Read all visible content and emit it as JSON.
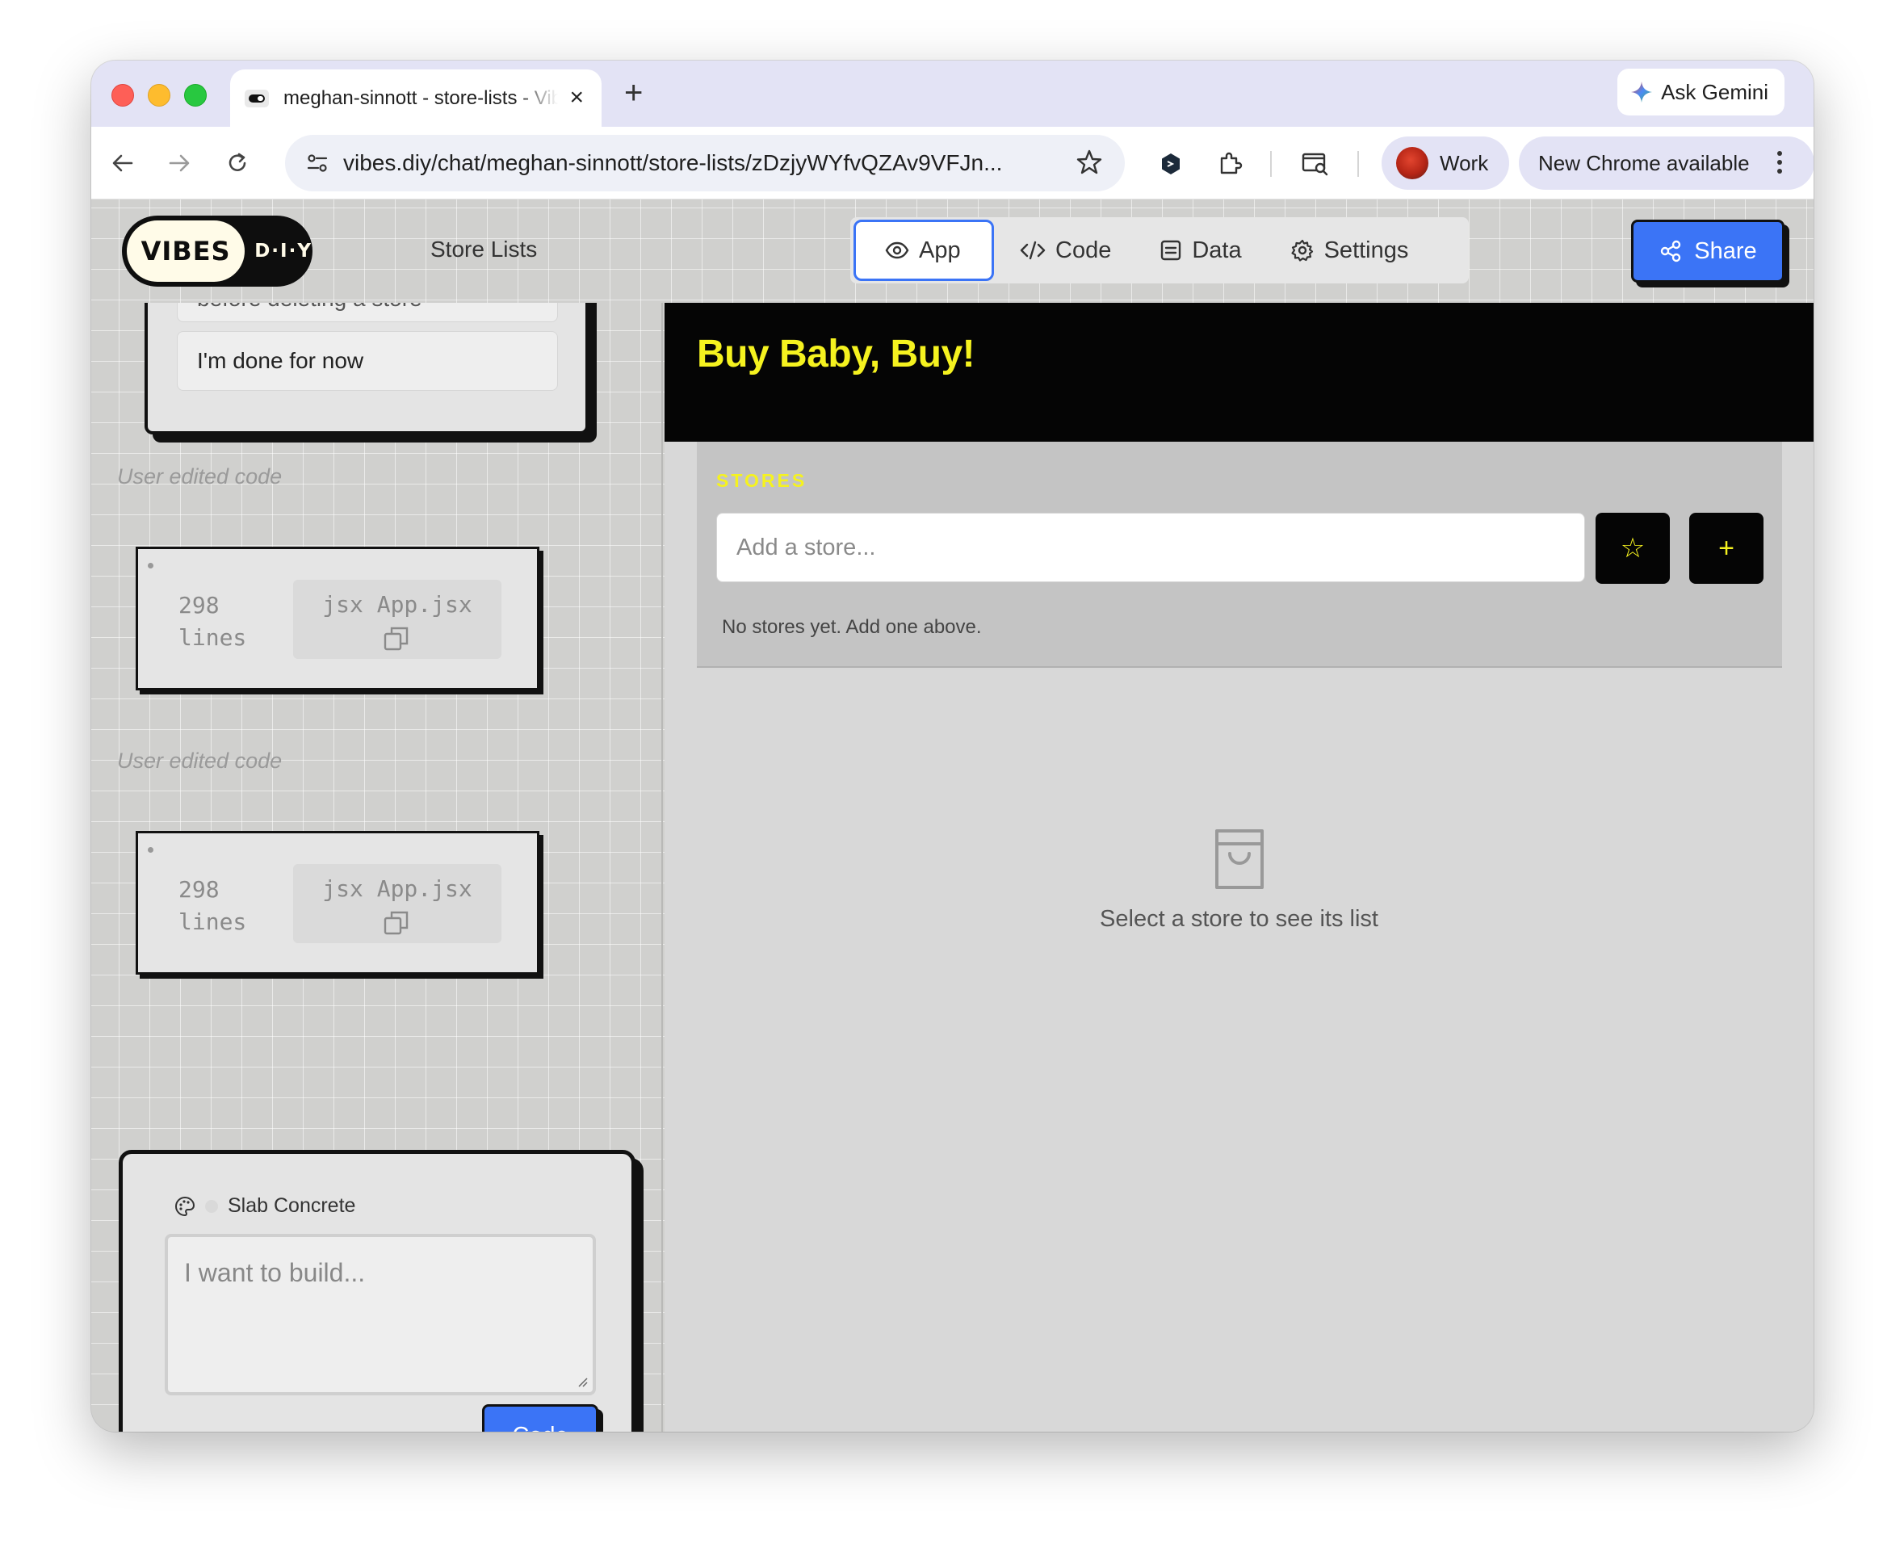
{
  "browser": {
    "tab_title": "meghan-sinnott - store-lists - Vibes DIY",
    "url": "vibes.diy/chat/meghan-sinnott/store-lists/zDzjyWYfvQZAv9VFJn...",
    "ask_gemini": "Ask Gemini",
    "profile_label": "Work",
    "update_label": "New Chrome available"
  },
  "header": {
    "logo_text": "VIBES",
    "logo_suffix": "D·I·Y",
    "page_title": "Store Lists",
    "tabs": [
      {
        "label": "App",
        "icon": "eye-icon",
        "active": true
      },
      {
        "label": "Code",
        "icon": "code-icon",
        "active": false
      },
      {
        "label": "Data",
        "icon": "database-icon",
        "active": false
      },
      {
        "label": "Settings",
        "icon": "gear-icon",
        "active": false
      }
    ],
    "share_label": "Share"
  },
  "chat": {
    "suggestion_partial": "before deleting a store",
    "suggestion_done": "I'm done for now",
    "edits": [
      {
        "note": "User edited code",
        "lines": "298 lines",
        "file": "jsx App.jsx"
      },
      {
        "note": "User edited code",
        "lines": "298 lines",
        "file": "jsx App.jsx"
      }
    ],
    "theme_name": "Slab Concrete",
    "prompt_placeholder": "I want to build...",
    "code_button": "Code"
  },
  "app": {
    "title": "Buy Baby, Buy!",
    "stores_label": "STORES",
    "store_input_placeholder": "Add a store...",
    "favorite_button": "☆",
    "add_button": "+",
    "no_stores_text": "No stores yet. Add one above.",
    "empty_state_text": "Select a store to see its list"
  },
  "colors": {
    "accent_blue": "#3b74f6",
    "app_yellow": "#f5f21f",
    "app_black": "#050505"
  }
}
